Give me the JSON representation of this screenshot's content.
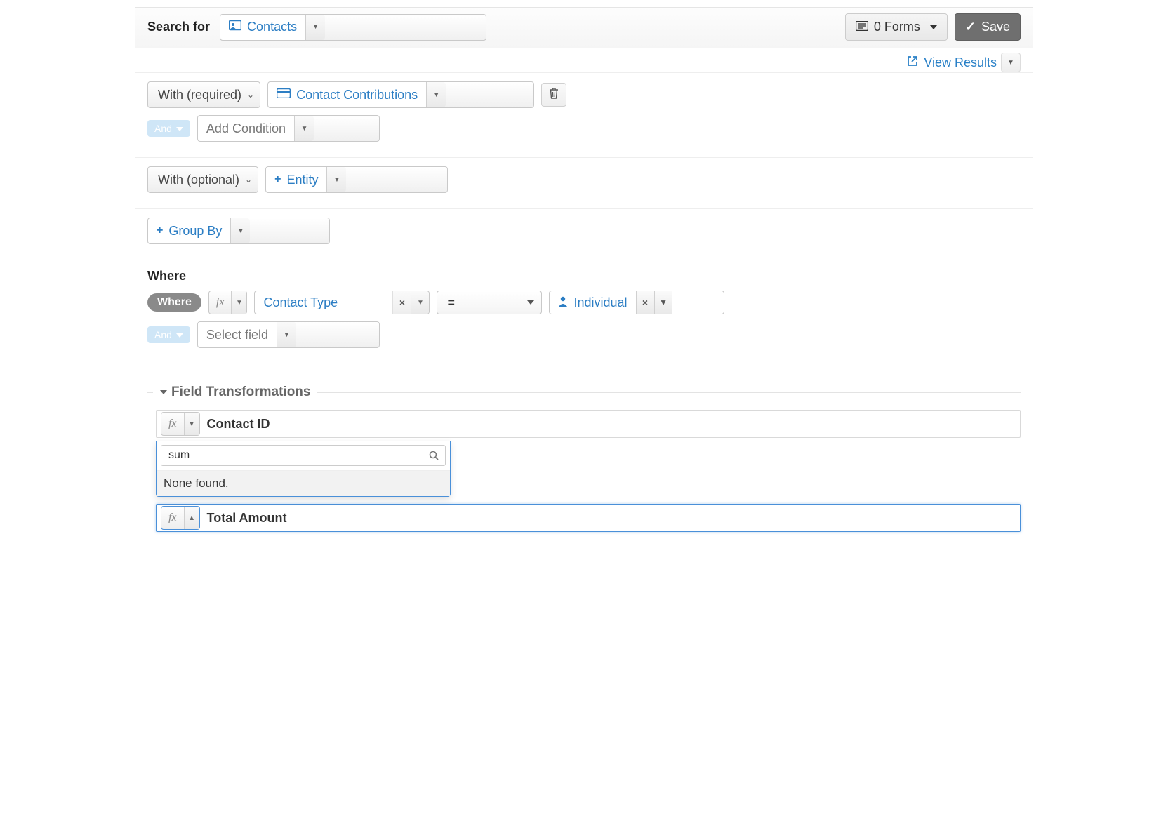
{
  "topbar": {
    "search_label": "Search for",
    "entity": "Contacts",
    "forms_label": "0 Forms",
    "save_label": "Save"
  },
  "view_results": "View Results",
  "with_required": {
    "label": "With (required)",
    "entity": "Contact Contributions"
  },
  "and_chip": "And",
  "add_condition_placeholder": "Add Condition",
  "with_optional": {
    "label": "With (optional)",
    "entity_placeholder": "Entity"
  },
  "group_by_label": "Group By",
  "where": {
    "heading": "Where",
    "pill": "Where",
    "fx": "fx",
    "field": "Contact Type",
    "operator": "=",
    "value": "Individual",
    "select_field_placeholder": "Select field"
  },
  "field_transformations": {
    "title": "Field Transformations",
    "rows": [
      {
        "fx": "fx",
        "label": "Contact ID"
      },
      {
        "fx": "fx",
        "label": "Total Amount"
      }
    ],
    "search_value": "sum",
    "none_found": "None found."
  }
}
